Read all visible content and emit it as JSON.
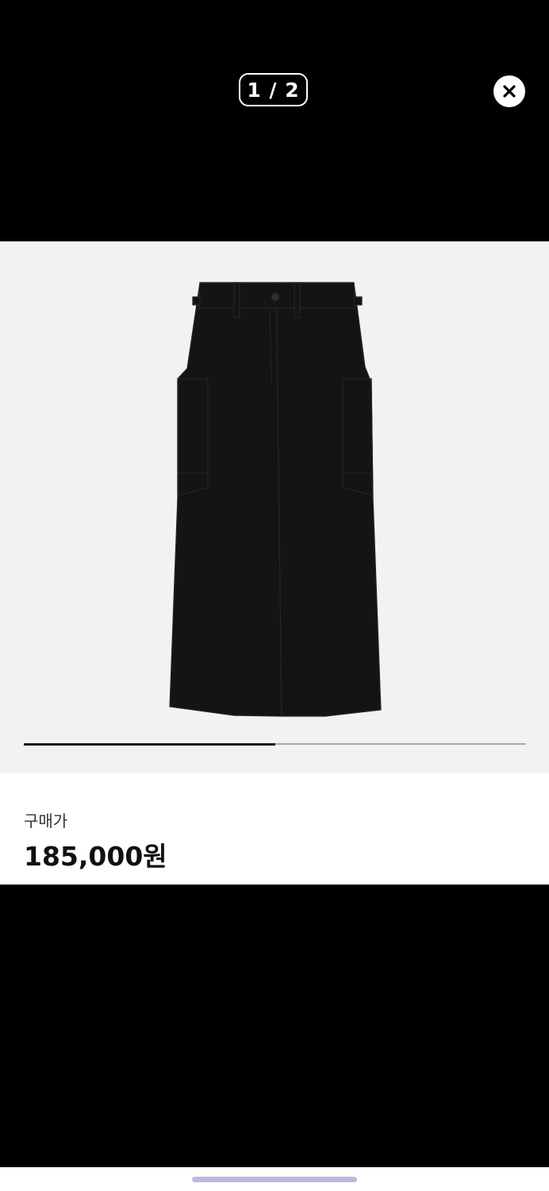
{
  "viewer": {
    "counter": "1 / 2",
    "current_page": 1,
    "total_pages": 2,
    "close_icon": "close-circle-icon"
  },
  "image": {
    "subject": "black wide-leg cargo pants",
    "background_color": "#f2f2f2",
    "progress_fraction": 0.5
  },
  "price": {
    "label": "구매가",
    "value": "185,000원"
  },
  "colors": {
    "backdrop": "#000000",
    "panel": "#ffffff",
    "progress_track": "#a8a8a8",
    "progress_fill": "#1a1a1a",
    "home_indicator": "#c2b6d9"
  }
}
